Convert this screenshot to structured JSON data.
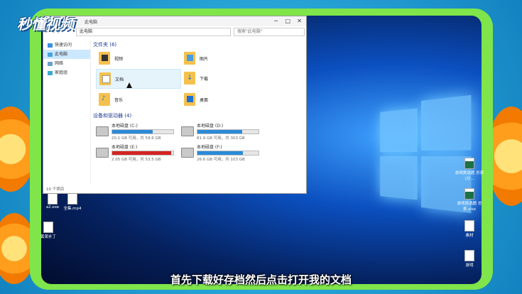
{
  "brand": "秒懂视频",
  "subtitle": "首先下载好存档然后点击打开我的文档",
  "explorer": {
    "title": "此电脑",
    "path": "此电脑",
    "search_placeholder": "搜索\"此电脑\"",
    "sidebar": [
      {
        "label": "快速访问",
        "icon": "star-icon"
      },
      {
        "label": "此电脑",
        "icon": "computer-icon",
        "selected": true
      },
      {
        "label": "网络",
        "icon": "network-icon"
      },
      {
        "label": "家庭组",
        "icon": "homegroup-icon"
      }
    ],
    "folders_header": "文件夹 (6)",
    "folders": [
      {
        "label": "视频",
        "icon": "video-folder-icon"
      },
      {
        "label": "图片",
        "icon": "pictures-folder-icon"
      },
      {
        "label": "文档",
        "icon": "documents-folder-icon",
        "selected": true
      },
      {
        "label": "下载",
        "icon": "downloads-folder-icon"
      },
      {
        "label": "音乐",
        "icon": "music-folder-icon"
      },
      {
        "label": "桌面",
        "icon": "desktop-folder-icon"
      }
    ],
    "drives_header": "设备和驱动器 (4)",
    "drives": [
      {
        "label": "本地磁盘 (C:)",
        "size": "20.1 GB 可用，共 59.6 GB",
        "used": 0.66,
        "red": false,
        "windows": true
      },
      {
        "label": "本地磁盘 (D:)",
        "size": "81.9 GB 可用，共 303 GB",
        "used": 0.73,
        "red": false
      },
      {
        "label": "本地磁盘 (E:)",
        "size": "2.05 GB 可用，共 53.5 GB",
        "used": 0.96,
        "red": true
      },
      {
        "label": "本地磁盘 (F:)",
        "size": "26.6 GB 可用，共 103 GB",
        "used": 0.74,
        "red": false
      }
    ],
    "status": "10 个项目"
  },
  "desktop": [
    {
      "label": "a2.exe"
    },
    {
      "label": "全集.mp4"
    },
    {
      "label": "黄莱补丁"
    },
    {
      "label": "游戏挑选题 总表 (分..."
    },
    {
      "label": "游戏挑选题 总表.xlsx"
    },
    {
      "label": "素材"
    },
    {
      "label": "游戏"
    }
  ]
}
